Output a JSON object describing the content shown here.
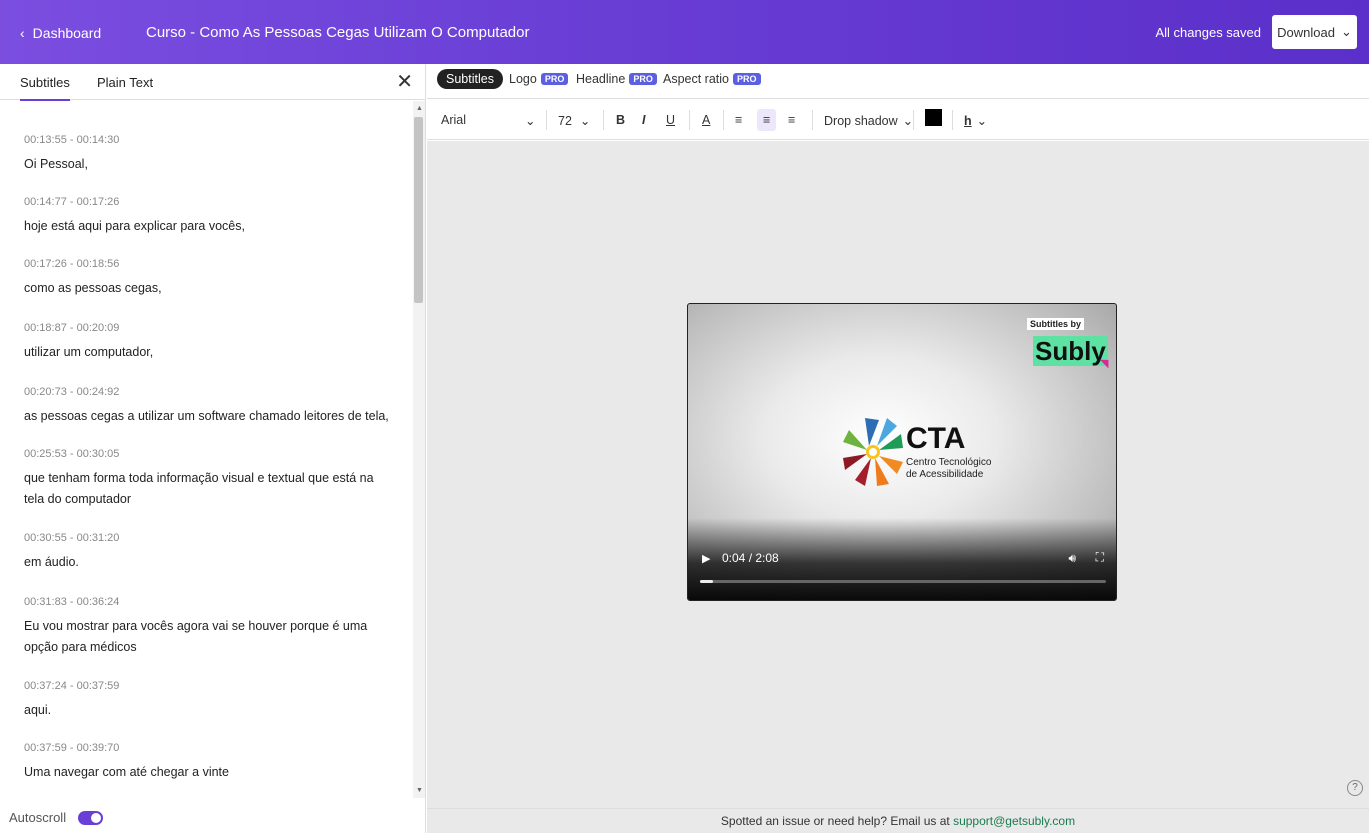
{
  "header": {
    "back_label": "Dashboard",
    "title": "Curso - Como As Pessoas Cegas Utilizam O Computador",
    "status": "All changes saved",
    "download_label": "Download"
  },
  "left_panel": {
    "tabs": [
      "Subtitles",
      "Plain Text"
    ],
    "subtitles": [
      {
        "time": "00:13:55  -  00:14:30",
        "text": "Oi Pessoal,"
      },
      {
        "time": "00:14:77  -  00:17:26",
        "text": "hoje está aqui para explicar para vocês,"
      },
      {
        "time": "00:17:26  -  00:18:56",
        "text": "como as pessoas cegas,"
      },
      {
        "time": "00:18:87  -  00:20:09",
        "text": "utilizar um computador,"
      },
      {
        "time": "00:20:73  -  00:24:92",
        "text": "as pessoas cegas a utilizar um software chamado leitores de tela,"
      },
      {
        "time": "00:25:53  -  00:30:05",
        "text": "que tenham forma toda informação visual e textual que está na tela do computador"
      },
      {
        "time": "00:30:55  -  00:31:20",
        "text": "em áudio."
      },
      {
        "time": "00:31:83  -  00:36:24",
        "text": "Eu vou mostrar para vocês agora vai se houver porque é uma opção para médicos"
      },
      {
        "time": "00:37:24  -  00:37:59",
        "text": "aqui."
      },
      {
        "time": "00:37:59  -  00:39:70",
        "text": "Uma navegar com até chegar a vinte"
      }
    ],
    "autoscroll_label": "Autoscroll",
    "autoscroll_on": true
  },
  "editor_tabs": [
    {
      "label": "Subtitles",
      "pro": false,
      "active": true
    },
    {
      "label": "Logo",
      "pro": true
    },
    {
      "label": "Headline",
      "pro": true
    },
    {
      "label": "Aspect ratio",
      "pro": true
    }
  ],
  "pro_badge": "PRO",
  "toolbar": {
    "font": "Arial",
    "size": "72",
    "shadow": "Drop shadow",
    "text_color": "#000000"
  },
  "video": {
    "watermark_by": "Subtitles by",
    "watermark_brand": "Subly",
    "logo_title": "CTA",
    "logo_sub1": "Centro Tecnológico",
    "logo_sub2": "de Acessibilidade",
    "time": "0:04 / 2:08",
    "progress": 0.032
  },
  "footer": {
    "text": "Spotted an issue or need help? Email us at ",
    "email": "support@getsubly.com"
  },
  "colors": {
    "accent": "#6a3fd6",
    "pro": "#5b5fe0",
    "subly_green": "#5de2a3"
  }
}
